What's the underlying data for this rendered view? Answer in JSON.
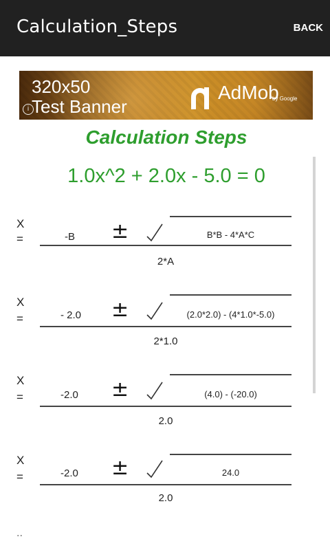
{
  "appbar": {
    "title": "Calculation_Steps",
    "back_label": "BACK"
  },
  "banner": {
    "size_text": "320x50",
    "test_text": "Test Banner",
    "info_icon": "info-icon",
    "brand_text": "AdMob",
    "by_text": "by Google"
  },
  "content": {
    "title": "Calculation Steps",
    "equation": "1.0x^2 + 2.0x - 5.0 = 0"
  },
  "steps": [
    {
      "x": "X",
      "eq": "=",
      "neg_b": "-B",
      "pm": "±",
      "radicand": "B*B - 4*A*C",
      "denominator": "2*A"
    },
    {
      "x": "X",
      "eq": "=",
      "neg_b": "- 2.0",
      "pm": "±",
      "radicand": "(2.0*2.0) - (4*1.0*-5.0)",
      "denominator": "2*1.0"
    },
    {
      "x": "X",
      "eq": "=",
      "neg_b": "-2.0",
      "pm": "±",
      "radicand": "(4.0) - (-20.0)",
      "denominator": "2.0"
    },
    {
      "x": "X",
      "eq": "=",
      "neg_b": "-2.0",
      "pm": "±",
      "radicand": "24.0",
      "denominator": "2.0"
    }
  ],
  "colors": {
    "appbar_bg": "#212121",
    "title_green": "#2e9e2e"
  }
}
